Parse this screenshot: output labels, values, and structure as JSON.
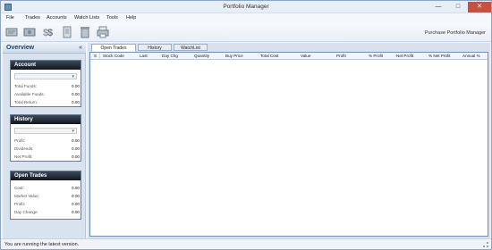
{
  "window": {
    "title": "Portfolio Manager",
    "min_glyph": "—",
    "max_glyph": "□",
    "close_glyph": "✕"
  },
  "menu": [
    "File",
    "Trades",
    "Accounts",
    "Watch Lists",
    "Tools",
    "Help"
  ],
  "toolbar": {
    "icons": [
      "buy-icon",
      "sell-icon",
      "money-icon",
      "document-icon",
      "delete-icon",
      "printer-icon"
    ],
    "purchase_label": "Purchase Portfolio Manager"
  },
  "sidebar": {
    "title": "Overview",
    "collapse_glyph": "«",
    "account": {
      "title": "Account",
      "rows": [
        {
          "label": "Total Funds:",
          "value": "0.00"
        },
        {
          "label": "Available Funds:",
          "value": "0.00"
        },
        {
          "label": "Total Return:",
          "value": "0.00"
        }
      ]
    },
    "history": {
      "title": "History",
      "rows": [
        {
          "label": "Profit:",
          "value": "0.00"
        },
        {
          "label": "Dividends:",
          "value": "0.00"
        },
        {
          "label": "Net Profit:",
          "value": "0.00"
        }
      ]
    },
    "open_trades": {
      "title": "Open Trades",
      "rows": [
        {
          "label": "Cost:",
          "value": "0.00"
        },
        {
          "label": "Market Value:",
          "value": "0.00"
        },
        {
          "label": "Profit:",
          "value": "0.00"
        },
        {
          "label": "Day Change:",
          "value": "0.00"
        }
      ]
    }
  },
  "tabs": [
    "Open Trades",
    "History",
    "WatchList"
  ],
  "grid": {
    "columns": [
      "S",
      "Stock Code",
      "Last",
      "Day Chg",
      "Quantity",
      "Buy Price",
      "Total Cost",
      "Value",
      "Profit",
      "% Profit",
      "Net Profit",
      "% Net Profit",
      "Annual %"
    ]
  },
  "status": {
    "message": "You are running the latest version."
  },
  "colors": {
    "accent": "#6f8fb5",
    "panel_header": "#0f1620",
    "close": "#c7503f"
  }
}
